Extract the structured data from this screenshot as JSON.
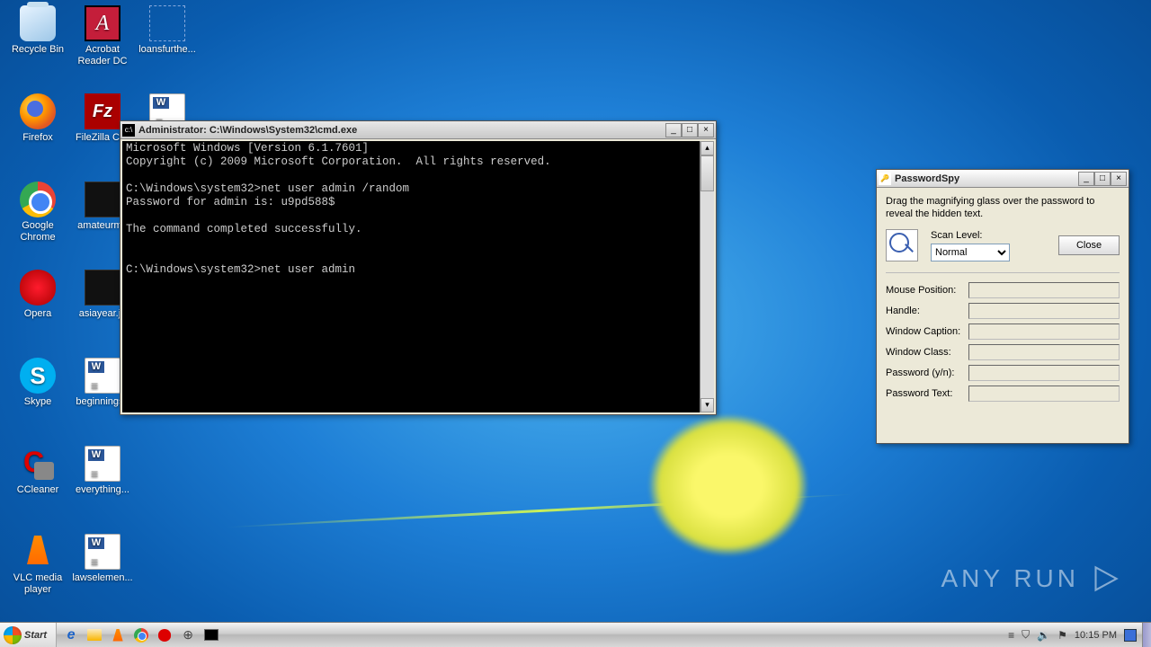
{
  "desktop": {
    "icons": [
      {
        "label": "Recycle Bin"
      },
      {
        "label": "Acrobat Reader DC"
      },
      {
        "label": "loansfurthe..."
      },
      {
        "label": "Firefox"
      },
      {
        "label": "FileZilla Clie"
      },
      {
        "label": "Google Chrome"
      },
      {
        "label": "amateurmo"
      },
      {
        "label": "Opera"
      },
      {
        "label": "asiayear.jp"
      },
      {
        "label": "Skype"
      },
      {
        "label": "beginningse"
      },
      {
        "label": "CCleaner"
      },
      {
        "label": "everything..."
      },
      {
        "label": "VLC media player"
      },
      {
        "label": "lawselemen..."
      }
    ]
  },
  "cmd": {
    "title": "Administrator: C:\\Windows\\System32\\cmd.exe",
    "lines": [
      "Microsoft Windows [Version 6.1.7601]",
      "Copyright (c) 2009 Microsoft Corporation.  All rights reserved.",
      "",
      "C:\\Windows\\system32>net user admin /random",
      "Password for admin is: u9pd588$",
      "",
      "The command completed successfully.",
      "",
      "",
      "C:\\Windows\\system32>net user admin"
    ]
  },
  "pspy": {
    "title": "PasswordSpy",
    "instruction": "Drag the magnifying glass over the password to reveal the hidden text.",
    "scan_label": "Scan Level:",
    "scan_value": "Normal",
    "close": "Close",
    "fields": [
      "Mouse Position:",
      "Handle:",
      "Window Caption:",
      "Window Class:",
      "Password (y/n):",
      "Password Text:"
    ]
  },
  "taskbar": {
    "start": "Start",
    "time": "10:15 PM"
  },
  "watermark": "ANY   RUN"
}
